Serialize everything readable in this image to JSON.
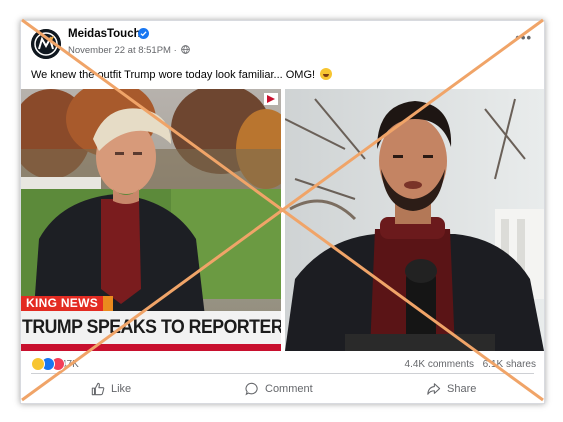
{
  "post": {
    "page_name": "MeidasTouch",
    "date": "November 22 at 8:51PM",
    "separator": "·",
    "more": "•••",
    "caption": "We knew the outfit Trump wore today look familiar... OMG!",
    "caption_emoji": "laughing-face-emoji"
  },
  "media": {
    "news_label": "KING NEWS",
    "ticker": "TRUMP SPEAKS TO REPORTERS AT THE"
  },
  "stats": {
    "reactions_count": "47K",
    "comments": "4.4K comments",
    "shares": "6.1K shares"
  },
  "actions": {
    "like": "Like",
    "comment": "Comment",
    "share": "Share"
  },
  "overlay": {
    "cross_color": "#f0a468"
  }
}
